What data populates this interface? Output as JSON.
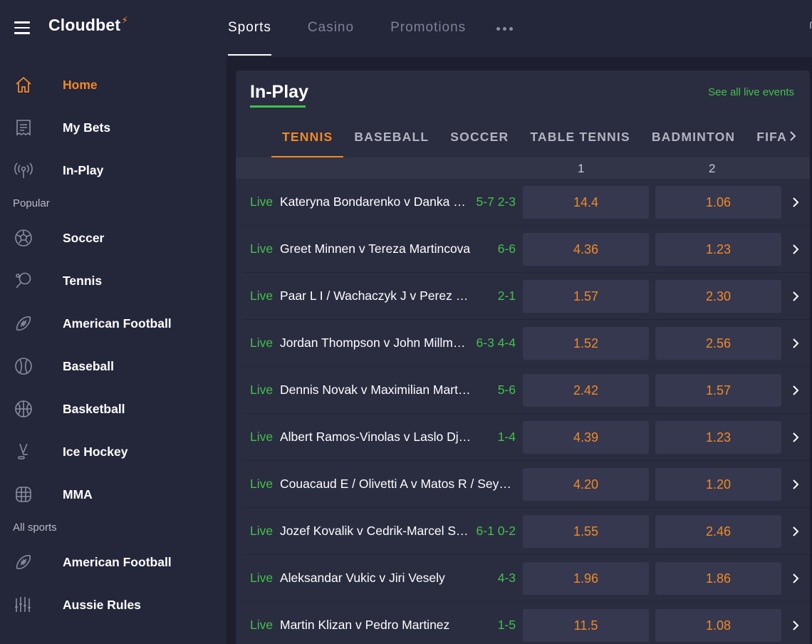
{
  "brand": {
    "name": "Cloudbet",
    "bolt": "⚡",
    "accent": "#f08a24",
    "live_green": "#43c14b"
  },
  "topnav": [
    {
      "label": "Sports"
    },
    {
      "label": "Casino"
    },
    {
      "label": "Promotions"
    }
  ],
  "sidebar": {
    "main": [
      {
        "label": "Home",
        "icon": "home-icon"
      },
      {
        "label": "My Bets",
        "icon": "receipt-icon"
      },
      {
        "label": "In-Play",
        "icon": "broadcast-icon"
      }
    ],
    "popular_heading": "Popular",
    "popular": [
      {
        "label": "Soccer",
        "icon": "soccer-icon"
      },
      {
        "label": "Tennis",
        "icon": "tennis-icon"
      },
      {
        "label": "American Football",
        "icon": "american-football-icon"
      },
      {
        "label": "Baseball",
        "icon": "baseball-icon"
      },
      {
        "label": "Basketball",
        "icon": "basketball-icon"
      },
      {
        "label": "Ice Hockey",
        "icon": "ice-hockey-icon"
      },
      {
        "label": "MMA",
        "icon": "mma-icon"
      }
    ],
    "all_heading": "All sports",
    "all": [
      {
        "label": "American Football",
        "icon": "american-football-icon"
      },
      {
        "label": "Aussie Rules",
        "icon": "aussie-rules-icon"
      }
    ]
  },
  "inplay": {
    "title": "In-Play",
    "see_all": "See all live events",
    "tabs": [
      "TENNIS",
      "BASEBALL",
      "SOCCER",
      "TABLE TENNIS",
      "BADMINTON",
      "FIFA"
    ],
    "col1": "1",
    "col2": "2",
    "events": [
      {
        "live": "Live",
        "name": "Kateryna Bondarenko v Danka K…",
        "score": "5-7 2-3",
        "odd1": "14.4",
        "odd2": "1.06"
      },
      {
        "live": "Live",
        "name": "Greet Minnen v Tereza Martincova",
        "score": "6-6",
        "odd1": "4.36",
        "odd2": "1.23"
      },
      {
        "live": "Live",
        "name": "Paar L I / Wachaczyk J v Perez E / …",
        "score": "2-1",
        "odd1": "1.57",
        "odd2": "2.30"
      },
      {
        "live": "Live",
        "name": "Jordan Thompson v John Millm…",
        "score": "6-3 4-4",
        "odd1": "1.52",
        "odd2": "2.56"
      },
      {
        "live": "Live",
        "name": "Dennis Novak v Maximilian Marterer",
        "score": "5-6",
        "odd1": "2.42",
        "odd2": "1.57"
      },
      {
        "live": "Live",
        "name": "Albert Ramos-Vinolas v Laslo Djere",
        "score": "1-4",
        "odd1": "4.39",
        "odd2": "1.23"
      },
      {
        "live": "Live",
        "name": "Couacaud E / Olivetti A v Matos R / Sey…",
        "score": "",
        "odd1": "4.20",
        "odd2": "1.20"
      },
      {
        "live": "Live",
        "name": "Jozef Kovalik v Cedrik-Marcel S…",
        "score": "6-1 0-2",
        "odd1": "1.55",
        "odd2": "2.46"
      },
      {
        "live": "Live",
        "name": "Aleksandar Vukic v Jiri Vesely",
        "score": "4-3",
        "odd1": "1.96",
        "odd2": "1.86"
      },
      {
        "live": "Live",
        "name": "Martin Klizan v Pedro Martinez",
        "score": "1-5",
        "odd1": "11.5",
        "odd2": "1.08"
      }
    ]
  }
}
